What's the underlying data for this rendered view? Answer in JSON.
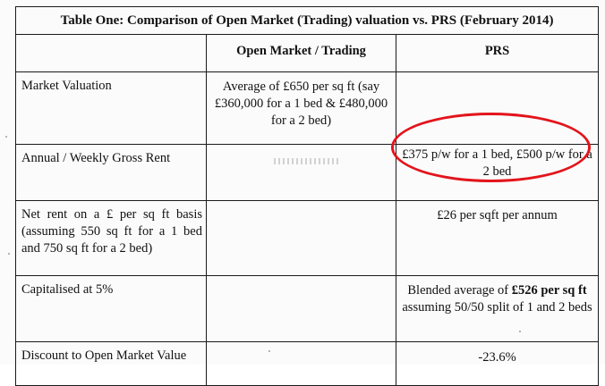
{
  "table": {
    "title": "Table One:  Comparison of Open Market (Trading) valuation vs. PRS (February 2014)",
    "headers": {
      "label": "",
      "open_market": "Open Market / Trading",
      "prs": "PRS"
    },
    "rows": [
      {
        "label": "Market Valuation",
        "open_market": "Average of £650 per sq ft (say £360,000 for a 1 bed & £480,000 for a 2 bed)",
        "prs": ""
      },
      {
        "label": "Annual / Weekly Gross Rent",
        "open_market": "",
        "prs": "£375 p/w for a 1 bed, £500 p/w for a 2 bed"
      },
      {
        "label": "Net rent on a £ per sq ft basis (assuming 550 sq ft for a 1 bed and 750 sq ft for a 2 bed)",
        "open_market": "",
        "prs": "£26 per sqft per annum"
      },
      {
        "label": "Capitalised at 5%",
        "open_market": "",
        "prs_before": "Blended average of ",
        "prs_bold": "£526 per sq ft",
        "prs_after": " assuming 50/50 split of 1 and 2 beds"
      },
      {
        "label": "Discount to Open Market Value",
        "open_market": "",
        "prs": "-23.6%"
      }
    ]
  },
  "annotation": {
    "color": "#e3141b",
    "shape": "hand-drawn ellipse around PRS rent cell"
  }
}
